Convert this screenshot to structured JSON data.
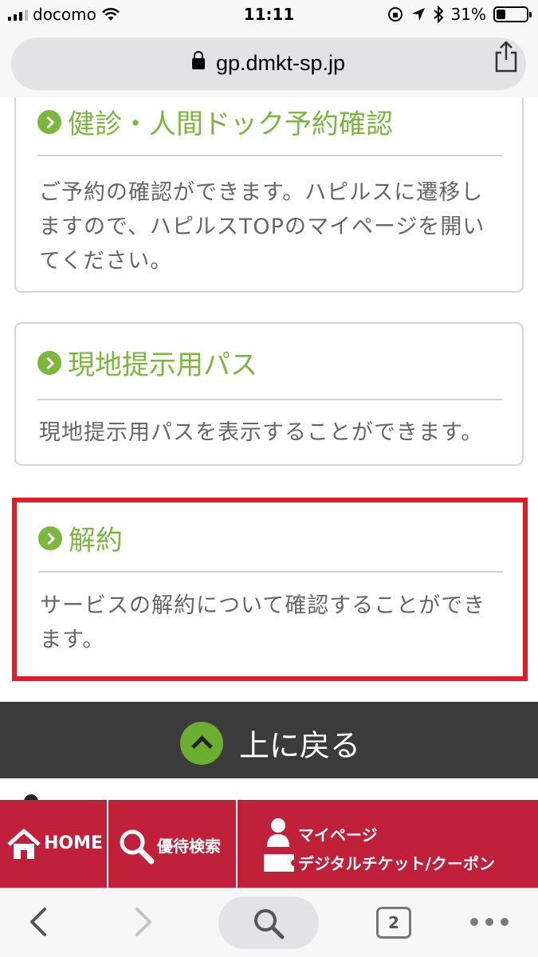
{
  "status_bar": {
    "carrier": "docomo",
    "time": "11:11",
    "battery_percent": "31%",
    "battery_level": 0.31
  },
  "browser": {
    "url": "gp.dmkt-sp.jp",
    "tab_count": "2"
  },
  "cards": [
    {
      "title": "健診・人間ドック予約確認",
      "desc_lines": [
        "ご予約の確認ができます。ハピルスに遷移し",
        "ますので、ハピルスTOPのマイページを開い",
        "てください。"
      ]
    },
    {
      "title": "現地提示用パス",
      "desc_lines": [
        "現地提示用パスを表示することができます。"
      ]
    },
    {
      "title": "解約",
      "desc_lines": [
        "サービスの解約について確認することができ",
        "ます。"
      ],
      "highlighted": true
    }
  ],
  "back_to_top": {
    "label": "上に戻る"
  },
  "bottom_nav": {
    "home_label": "HOME",
    "search_label": "優待検索",
    "mypage_label": "マイページ",
    "ticket_label": "デジタルチケット/クーポン"
  },
  "colors": {
    "accent_green": "#79b83a",
    "highlight_red": "#e01c24",
    "nav_red": "#c0203a",
    "back_top_bg": "#3b3b3b"
  },
  "icons": [
    "lock-icon",
    "share-icon",
    "chevron-right-icon",
    "chevron-up-icon",
    "home-icon",
    "search-icon",
    "person-icon",
    "ticket-icon",
    "back-icon",
    "forward-icon",
    "tabs-icon",
    "more-icon"
  ]
}
